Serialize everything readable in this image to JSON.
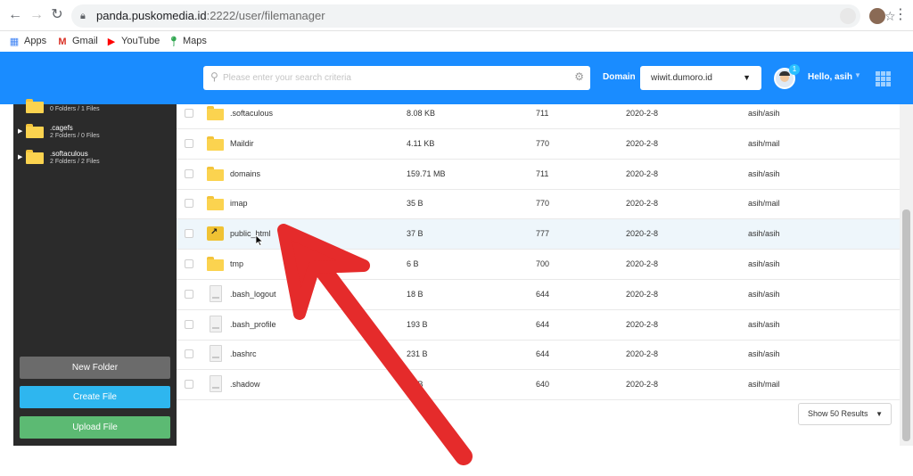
{
  "browser": {
    "url_host": "panda.puskomedia.id",
    "url_path": ":2222/user/filemanager",
    "bookmarks": [
      {
        "label": "Apps",
        "icon": "apps-grid-icon"
      },
      {
        "label": "Gmail",
        "icon": "gmail-icon"
      },
      {
        "label": "YouTube",
        "icon": "youtube-icon"
      },
      {
        "label": "Maps",
        "icon": "maps-pin-icon"
      }
    ]
  },
  "header": {
    "search_placeholder": "Please enter your search criteria",
    "domain_label": "Domain",
    "domain_value": "wiwit.dumoro.id",
    "notification_count": "1",
    "greeting": "Hello, asih"
  },
  "sidebar": {
    "tree": [
      {
        "name": "",
        "info": "0 Folders / 1 Files"
      },
      {
        "name": ".cagefs",
        "info": "2 Folders / 0 Files"
      },
      {
        "name": ".softaculous",
        "info": "2 Folders / 2 Files"
      }
    ],
    "new_folder_label": "New Folder",
    "create_file_label": "Create File",
    "upload_file_label": "Upload File"
  },
  "files": [
    {
      "name": ".softaculous",
      "size": "8.08 KB",
      "perm": "711",
      "date": "2020-2-8",
      "owner": "asih/asih",
      "type": "folder"
    },
    {
      "name": "Maildir",
      "size": "4.11 KB",
      "perm": "770",
      "date": "2020-2-8",
      "owner": "asih/mail",
      "type": "folder"
    },
    {
      "name": "domains",
      "size": "159.71 MB",
      "perm": "711",
      "date": "2020-2-8",
      "owner": "asih/asih",
      "type": "folder"
    },
    {
      "name": "imap",
      "size": "35 B",
      "perm": "770",
      "date": "2020-2-8",
      "owner": "asih/mail",
      "type": "folder"
    },
    {
      "name": "public_html",
      "size": "37 B",
      "perm": "777",
      "date": "2020-2-8",
      "owner": "asih/asih",
      "type": "link"
    },
    {
      "name": "tmp",
      "size": "6 B",
      "perm": "700",
      "date": "2020-2-8",
      "owner": "asih/asih",
      "type": "folder"
    },
    {
      "name": ".bash_logout",
      "size": "18 B",
      "perm": "644",
      "date": "2020-2-8",
      "owner": "asih/asih",
      "type": "file"
    },
    {
      "name": ".bash_profile",
      "size": "193 B",
      "perm": "644",
      "date": "2020-2-8",
      "owner": "asih/asih",
      "type": "file"
    },
    {
      "name": ".bashrc",
      "size": "231 B",
      "perm": "644",
      "date": "2020-2-8",
      "owner": "asih/asih",
      "type": "file"
    },
    {
      "name": ".shadow",
      "size": "98 B",
      "perm": "640",
      "date": "2020-2-8",
      "owner": "asih/mail",
      "type": "file"
    }
  ],
  "pagination": {
    "show_results_label": "Show 50 Results"
  },
  "colors": {
    "header_blue": "#1a8cff",
    "sidebar_dark": "#2b2b2b",
    "create_blue": "#2eb6ef",
    "upload_green": "#5cba73",
    "arrow_red": "#e52b2b"
  }
}
